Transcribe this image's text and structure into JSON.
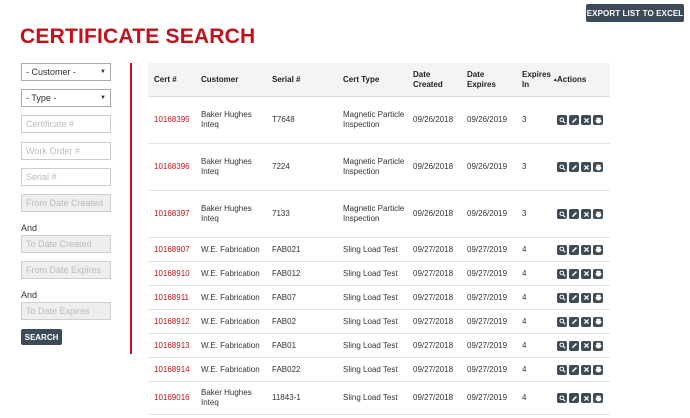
{
  "export_button": "EXPORT LIST TO EXCEL",
  "title": "CERTIFICATE SEARCH",
  "filters": {
    "customer": "- Customer -",
    "type": "- Type -",
    "certificate_placeholder": "Certificate #",
    "work_order_placeholder": "Work Order #",
    "serial_placeholder": "Serial #",
    "from_date_created_placeholder": "From Date Created",
    "and_1": "And",
    "to_date_created_placeholder": "To Date Created",
    "from_date_expires_placeholder": "From Date Expires",
    "and_2": "And",
    "to_date_expires_placeholder": "To Date Expires",
    "search_button": "SEARCH"
  },
  "table": {
    "headers": {
      "cert": "Cert #",
      "customer": "Customer",
      "serial": "Serial #",
      "cert_type": "Cert Type",
      "date_created": "Date Created",
      "date_expires": "Date Expires",
      "expires_in": "Expires In",
      "actions": "Actions"
    },
    "rows": [
      {
        "cert": "10168395",
        "customer": "Baker Hughes Inteq",
        "serial": "T7648",
        "cert_type": "Magnetic Particle Inspection",
        "created": "09/26/2018",
        "expires": "09/26/2019",
        "expires_in": "3"
      },
      {
        "cert": "10168396",
        "customer": "Baker Hughes Inteq",
        "serial": "7224",
        "cert_type": "Magnetic Particle Inspection",
        "created": "09/26/2018",
        "expires": "09/26/2019",
        "expires_in": "3"
      },
      {
        "cert": "10168397",
        "customer": "Baker Hughes Inteq",
        "serial": "7133",
        "cert_type": "Magnetic Particle Inspection",
        "created": "09/26/2018",
        "expires": "09/26/2019",
        "expires_in": "3"
      },
      {
        "cert": "10168907",
        "customer": "W.E. Fabrication",
        "serial": "FAB021",
        "cert_type": "Sling Load Test",
        "created": "09/27/2018",
        "expires": "09/27/2019",
        "expires_in": "4"
      },
      {
        "cert": "10168910",
        "customer": "W.E. Fabrication",
        "serial": "FAB012",
        "cert_type": "Sling Load Test",
        "created": "09/27/2018",
        "expires": "09/27/2019",
        "expires_in": "4"
      },
      {
        "cert": "10168911",
        "customer": "W.E. Fabrication",
        "serial": "FAB07",
        "cert_type": "Sling Load Test",
        "created": "09/27/2018",
        "expires": "09/27/2019",
        "expires_in": "4"
      },
      {
        "cert": "10168912",
        "customer": "W.E. Fabrication",
        "serial": "FAB02",
        "cert_type": "Sling Load Test",
        "created": "09/27/2018",
        "expires": "09/27/2019",
        "expires_in": "4"
      },
      {
        "cert": "10168913",
        "customer": "W.E. Fabrication",
        "serial": "FAB01",
        "cert_type": "Sling Load Test",
        "created": "09/27/2018",
        "expires": "09/27/2019",
        "expires_in": "4"
      },
      {
        "cert": "10168914",
        "customer": "W.E. Fabrication",
        "serial": "FAB022",
        "cert_type": "Sling Load Test",
        "created": "09/27/2018",
        "expires": "09/27/2019",
        "expires_in": "4"
      },
      {
        "cert": "10169016",
        "customer": "Baker Hughes Inteq",
        "serial": "11843-1",
        "cert_type": "Sling Load Test",
        "created": "09/27/2018",
        "expires": "09/27/2019",
        "expires_in": "4"
      }
    ]
  },
  "action_icons": [
    "search-icon",
    "edit-icon",
    "delete-icon",
    "print-icon"
  ],
  "colors": {
    "accent": "#c1121c",
    "button": "#3d4a57"
  }
}
